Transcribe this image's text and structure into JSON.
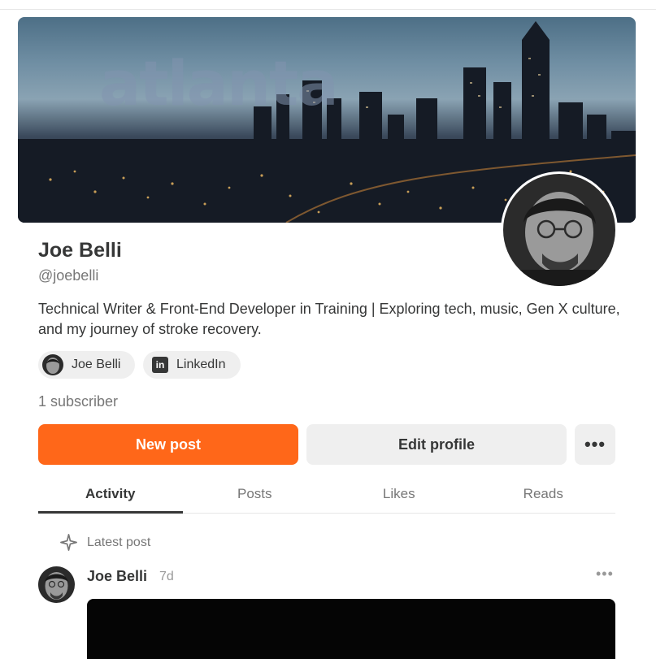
{
  "banner": {
    "word": "atlanta"
  },
  "profile": {
    "name": "Joe Belli",
    "handle": "@joebelli",
    "bio": "Technical Writer & Front-End Developer in Training | Exploring tech, music, Gen X culture, and my journey of stroke recovery.",
    "subscribers": "1 subscriber"
  },
  "links": [
    {
      "label": "Joe Belli",
      "icon": "avatar"
    },
    {
      "label": "LinkedIn",
      "icon": "linkedin-icon"
    }
  ],
  "actions": {
    "new_post": "New post",
    "edit_profile": "Edit profile",
    "more": "•••"
  },
  "tabs": [
    "Activity",
    "Posts",
    "Likes",
    "Reads"
  ],
  "activity": {
    "section_label": "Latest post",
    "post": {
      "author": "Joe Belli",
      "time": "7d",
      "more": "•••"
    }
  },
  "colors": {
    "accent": "#ff6719",
    "text": "#363737",
    "muted": "#777777",
    "chip": "#efefef"
  }
}
